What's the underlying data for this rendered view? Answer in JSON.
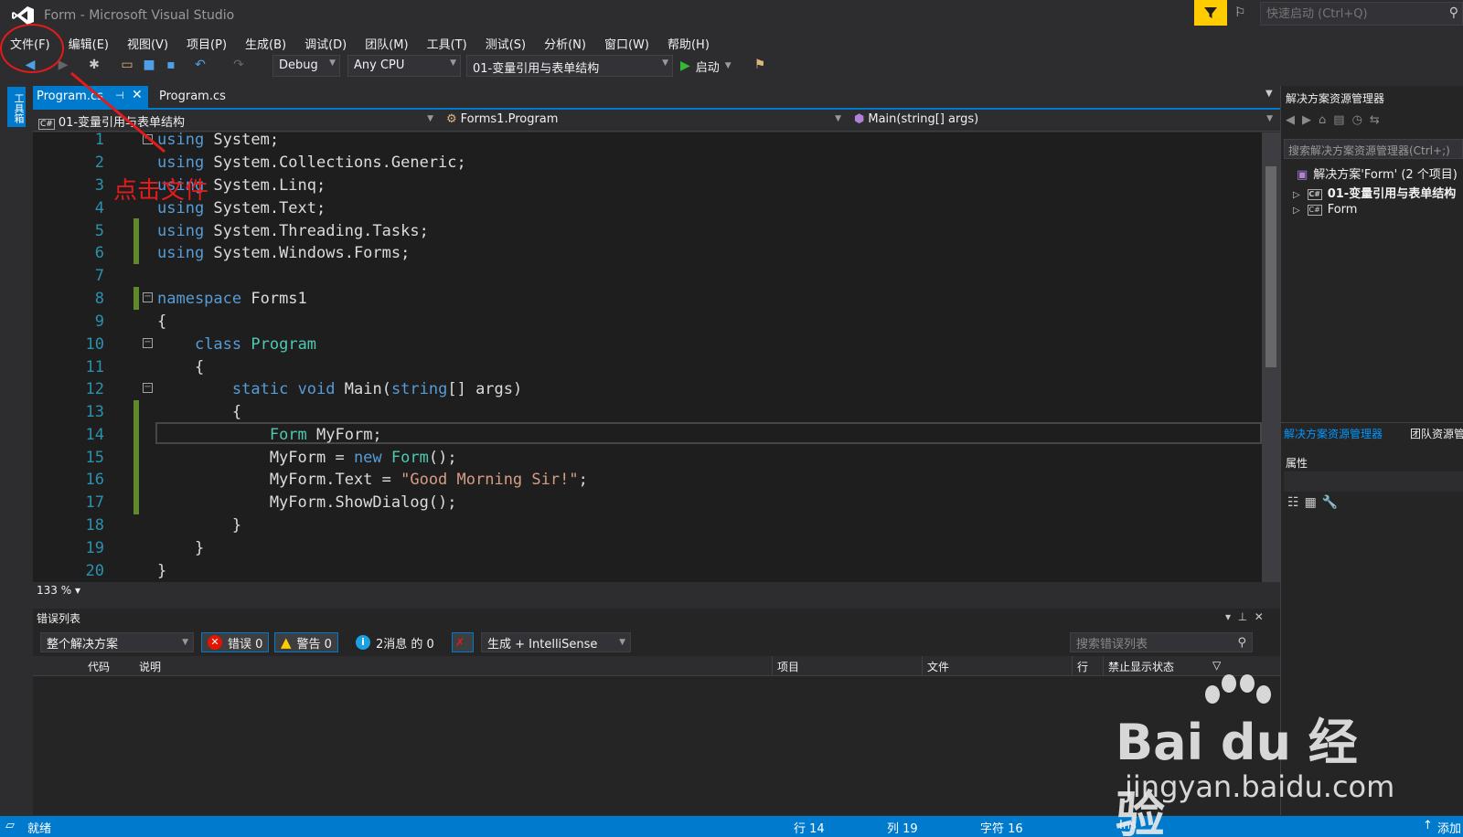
{
  "window": {
    "title": "Form - Microsoft Visual Studio",
    "quick_launch_placeholder": "快速启动 (Ctrl+Q)"
  },
  "menu": [
    "文件(F)",
    "编辑(E)",
    "视图(V)",
    "项目(P)",
    "生成(B)",
    "调试(D)",
    "团队(M)",
    "工具(T)",
    "测试(S)",
    "分析(N)",
    "窗口(W)",
    "帮助(H)"
  ],
  "toolbar": {
    "configuration": "Debug",
    "platform": "Any CPU",
    "startup_project": "01-变量引用与表单结构",
    "start_label": "启动"
  },
  "toolbox_tab": "工具箱",
  "tabs": {
    "active": "Program.cs",
    "inactive": "Program.cs"
  },
  "navbar": {
    "project": "01-变量引用与表单结构",
    "class": "Forms1.Program",
    "member": "Main(string[] args)"
  },
  "editor": {
    "zoom": "133 %",
    "line_numbers": [
      "1",
      "2",
      "3",
      "4",
      "5",
      "6",
      "7",
      "8",
      "9",
      "10",
      "11",
      "12",
      "13",
      "14",
      "15",
      "16",
      "17",
      "18",
      "19",
      "20"
    ],
    "lines": [
      "using System;",
      "using System.Collections.Generic;",
      "using System.Linq;",
      "using System.Text;",
      "using System.Threading.Tasks;",
      "using System.Windows.Forms;",
      "",
      "namespace Forms1",
      "{",
      "    class Program",
      "    {",
      "        static void Main(string[] args)",
      "        {",
      "            Form MyForm;",
      "            MyForm = new Form();",
      "            MyForm.Text = \"Good Morning Sir!\";",
      "            MyForm.ShowDialog();",
      "        }",
      "    }",
      "}"
    ]
  },
  "error_list": {
    "title": "错误列表",
    "scope": "整个解决方案",
    "errors": "错误 0",
    "warnings": "警告 0",
    "messages": "2消息 的 0",
    "build_filter": "生成 + IntelliSense",
    "search_placeholder": "搜索错误列表",
    "columns": [
      "代码",
      "说明",
      "项目",
      "文件",
      "行",
      "禁止显示状态"
    ]
  },
  "solution_explorer": {
    "title": "解决方案资源管理器",
    "search_placeholder": "搜索解决方案资源管理器(Ctrl+;)",
    "solution": "解决方案'Form' (2 个项目)",
    "projects": [
      "01-变量引用与表单结构",
      "Form"
    ],
    "tab_active": "解决方案资源管理器",
    "tab_other": "团队资源管"
  },
  "properties": {
    "title": "属性"
  },
  "statusbar": {
    "ready": "就绪",
    "line": "行 14",
    "col": "列 19",
    "char": "字符 16",
    "mode": "Ins",
    "add": "添加"
  },
  "annotation": {
    "text": "点击文件"
  },
  "watermark": {
    "logo": "Bai du 经验",
    "url": "jingyan.baidu.com"
  },
  "colors": {
    "accent": "#007acc",
    "keyword": "#569cd6",
    "type": "#4ec9b0",
    "string": "#d69d85",
    "annotation": "#e21b1b"
  }
}
